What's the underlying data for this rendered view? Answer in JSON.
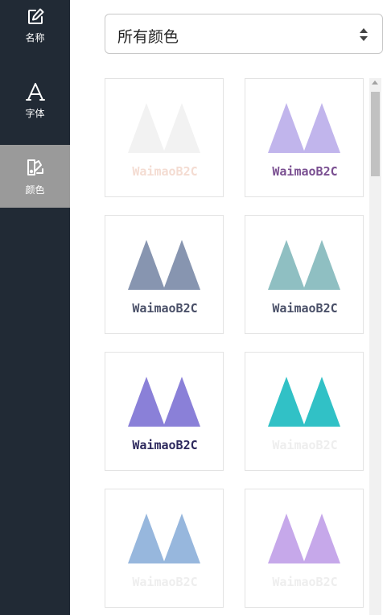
{
  "sidebar": {
    "items": [
      {
        "label": "名称",
        "icon": "edit-icon",
        "active": false
      },
      {
        "label": "字体",
        "icon": "font-icon",
        "active": false
      },
      {
        "label": "颜色",
        "icon": "palette-icon",
        "active": true
      }
    ]
  },
  "color_select": {
    "value": "所有颜色"
  },
  "logos": [
    {
      "text": "WaimaoB2C",
      "logo_color": "#f2f2f2",
      "text_color": "#f4dcd2"
    },
    {
      "text": "WaimaoB2C",
      "logo_color": "#c1b5ec",
      "text_color": "#7a4f91"
    },
    {
      "text": "WaimaoB2C",
      "logo_color": "#8795b0",
      "text_color": "#4a5068"
    },
    {
      "text": "WaimaoB2C",
      "logo_color": "#8fbfc2",
      "text_color": "#4a5068"
    },
    {
      "text": "WaimaoB2C",
      "logo_color": "#8a80d8",
      "text_color": "#2e2a5e"
    },
    {
      "text": "WaimaoB2C",
      "logo_color": "#31c1c6",
      "text_color": "#eeeeee"
    },
    {
      "text": "WaimaoB2C",
      "logo_color": "#97b7dd",
      "text_color": "#eeeeee"
    },
    {
      "text": "WaimaoB2C",
      "logo_color": "#c6a8ea",
      "text_color": "#eeeeee"
    }
  ]
}
